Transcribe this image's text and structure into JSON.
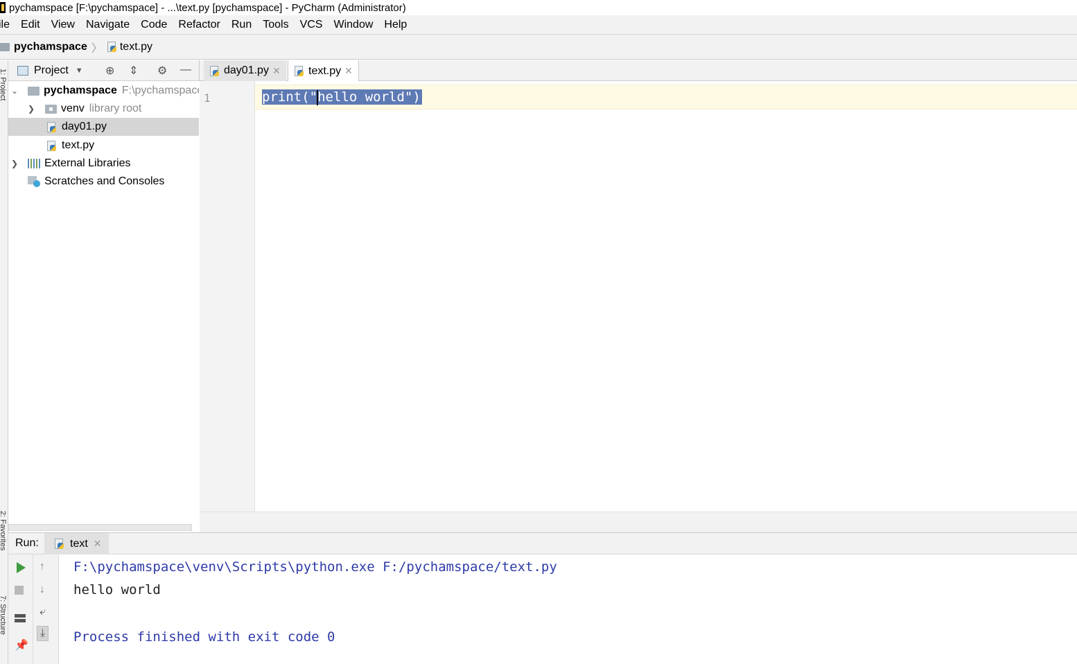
{
  "window": {
    "title": "pychamspace [F:\\pychamspace] - ...\\text.py [pychamspace] - PyCharm (Administrator)"
  },
  "menu": {
    "items": [
      "ile",
      "Edit",
      "View",
      "Navigate",
      "Code",
      "Refactor",
      "Run",
      "Tools",
      "VCS",
      "Window",
      "Help"
    ]
  },
  "breadcrumb": {
    "project": "pychamspace",
    "file": "text.py"
  },
  "side_strip": {
    "project_label": "1: Project",
    "favorites_label": "2: Favorites",
    "structure_label": "7: Structure"
  },
  "project_panel": {
    "view_label": "Project",
    "tree": {
      "root_name": "pychamspace",
      "root_path": "F:\\pychamspace",
      "venv_name": "venv",
      "venv_hint": "library root",
      "file1": "day01.py",
      "file2": "text.py",
      "external": "External Libraries",
      "scratches": "Scratches and Consoles"
    }
  },
  "editor": {
    "tabs": [
      {
        "label": "day01.py",
        "active": false
      },
      {
        "label": "text.py",
        "active": true
      }
    ],
    "line_number": "1",
    "code": {
      "before_cursor": "print(\"",
      "after_cursor": "hello world\")"
    }
  },
  "run_panel": {
    "label": "Run:",
    "tab_label": "text",
    "console": {
      "command": "F:\\pychamspace\\venv\\Scripts\\python.exe F:/pychamspace/text.py",
      "output": "hello world",
      "finish": "Process finished with exit code 0"
    }
  },
  "colors": {
    "selection": "#5e7ab5",
    "caret_line": "#fffae3",
    "console_blue": "#2d3aa7",
    "run_green": "#3f9c3f"
  }
}
